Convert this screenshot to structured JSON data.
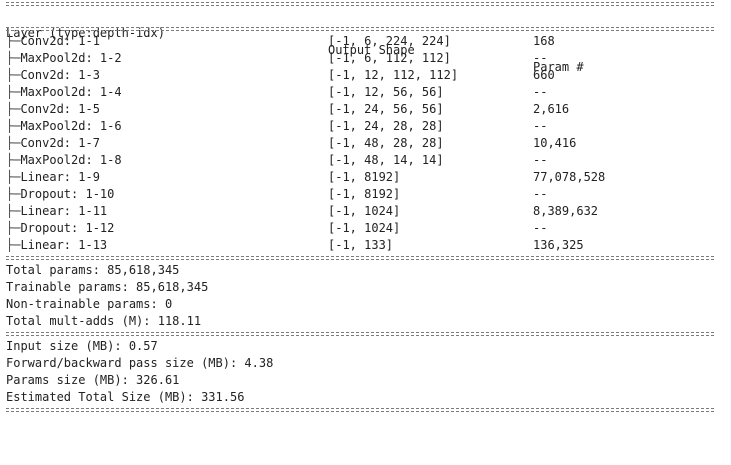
{
  "header": {
    "layer_col": "Layer (type:depth-idx)",
    "shape_col": "Output Shape",
    "param_col": "Param #"
  },
  "tree_prefix": "├─",
  "tree_prefix_last": "└─",
  "rows": [
    {
      "layer": "Conv2d: 1-1",
      "shape": "[-1, 6, 224, 224]",
      "params": "168"
    },
    {
      "layer": "MaxPool2d: 1-2",
      "shape": "[-1, 6, 112, 112]",
      "params": "--"
    },
    {
      "layer": "Conv2d: 1-3",
      "shape": "[-1, 12, 112, 112]",
      "params": "660"
    },
    {
      "layer": "MaxPool2d: 1-4",
      "shape": "[-1, 12, 56, 56]",
      "params": "--"
    },
    {
      "layer": "Conv2d: 1-5",
      "shape": "[-1, 24, 56, 56]",
      "params": "2,616"
    },
    {
      "layer": "MaxPool2d: 1-6",
      "shape": "[-1, 24, 28, 28]",
      "params": "--"
    },
    {
      "layer": "Conv2d: 1-7",
      "shape": "[-1, 48, 28, 28]",
      "params": "10,416"
    },
    {
      "layer": "MaxPool2d: 1-8",
      "shape": "[-1, 48, 14, 14]",
      "params": "--"
    },
    {
      "layer": "Linear: 1-9",
      "shape": "[-1, 8192]",
      "params": "77,078,528"
    },
    {
      "layer": "Dropout: 1-10",
      "shape": "[-1, 8192]",
      "params": "--"
    },
    {
      "layer": "Linear: 1-11",
      "shape": "[-1, 1024]",
      "params": "8,389,632"
    },
    {
      "layer": "Dropout: 1-12",
      "shape": "[-1, 1024]",
      "params": "--"
    },
    {
      "layer": "Linear: 1-13",
      "shape": "[-1, 133]",
      "params": "136,325"
    }
  ],
  "totals": {
    "total_params": "Total params: 85,618,345",
    "trainable_params": "Trainable params: 85,618,345",
    "non_trainable_params": "Non-trainable params: 0",
    "mult_adds": "Total mult-adds (M): 118.11"
  },
  "sizes": {
    "input_size": "Input size (MB): 0.57",
    "fwd_bwd_size": "Forward/backward pass size (MB): 4.38",
    "params_size": "Params size (MB): 326.61",
    "estimated_total": "Estimated Total Size (MB): 331.56"
  }
}
